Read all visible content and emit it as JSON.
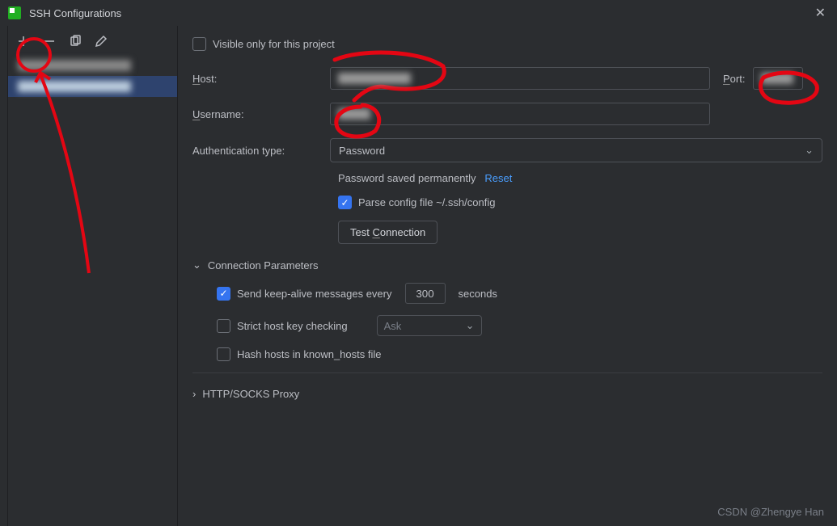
{
  "title": "SSH Configurations",
  "toolbar_icons": {
    "add": "add-icon",
    "remove": "remove-icon",
    "copy": "copy-icon",
    "edit": "edit-icon"
  },
  "form": {
    "visible_only_label": "Visible only for this project",
    "visible_only_checked": false,
    "host_label": "Host:",
    "host_value": "",
    "port_label": "Port:",
    "port_value": "",
    "username_label": "Username:",
    "username_value": "",
    "auth_type_label": "Authentication type:",
    "auth_type_value": "Password",
    "password_saved_text": "Password saved permanently",
    "reset_link": "Reset",
    "parse_config_label": "Parse config file ~/.ssh/config",
    "parse_config_checked": true,
    "test_connection_label": "Test Connection"
  },
  "conn_params": {
    "header": "Connection Parameters",
    "expanded": true,
    "keepalive_checked": true,
    "keepalive_prefix": "Send keep-alive messages every",
    "keepalive_value": "300",
    "keepalive_suffix": "seconds",
    "strict_checked": false,
    "strict_label": "Strict host key checking",
    "strict_select": "Ask",
    "hash_checked": false,
    "hash_label": "Hash hosts in known_hosts file"
  },
  "proxy": {
    "header": "HTTP/SOCKS Proxy",
    "expanded": false
  },
  "watermark": "CSDN @Zhengye Han"
}
